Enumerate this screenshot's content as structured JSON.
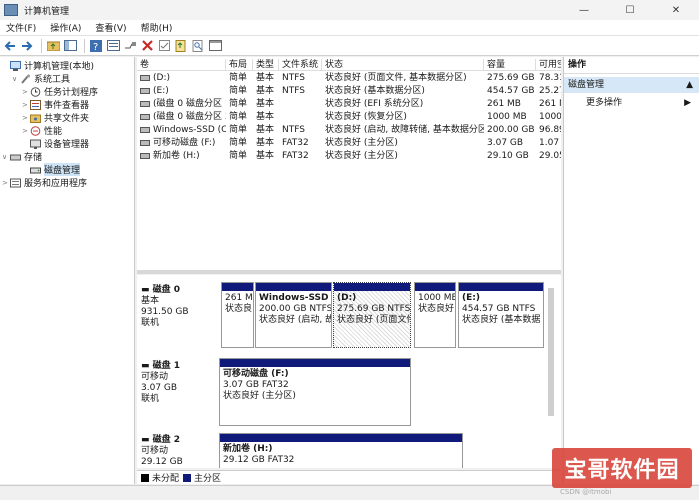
{
  "window": {
    "title": "计算机管理",
    "minimize": "—",
    "maximize": "☐",
    "close": "✕"
  },
  "menu": [
    "文件(F)",
    "操作(A)",
    "查看(V)",
    "帮助(H)"
  ],
  "toolbar_icons": [
    "back-arrow-icon",
    "forward-arrow-icon",
    "folder-up-icon",
    "show-tree-icon",
    "help-icon",
    "properties-icon",
    "connect-icon",
    "delete-icon",
    "check-icon",
    "export-icon",
    "search-icon",
    "window-icon"
  ],
  "tree": [
    {
      "label": "计算机管理(本地)",
      "level": 0,
      "expander": "",
      "icon": "computer-icon"
    },
    {
      "label": "系统工具",
      "level": 1,
      "expander": "∨",
      "icon": "tools-icon"
    },
    {
      "label": "任务计划程序",
      "level": 2,
      "expander": ">",
      "icon": "clock-icon"
    },
    {
      "label": "事件查看器",
      "level": 2,
      "expander": ">",
      "icon": "event-viewer-icon"
    },
    {
      "label": "共享文件夹",
      "level": 2,
      "expander": ">",
      "icon": "shared-folder-icon"
    },
    {
      "label": "性能",
      "level": 2,
      "expander": ">",
      "icon": "performance-icon"
    },
    {
      "label": "设备管理器",
      "level": 2,
      "expander": "",
      "icon": "device-manager-icon"
    },
    {
      "label": "存储",
      "level": 1,
      "expander": "∨",
      "icon": "storage-icon"
    },
    {
      "label": "磁盘管理",
      "level": 2,
      "expander": "",
      "icon": "disk-management-icon",
      "selected": true
    },
    {
      "label": "服务和应用程序",
      "level": 1,
      "expander": ">",
      "icon": "services-icon"
    }
  ],
  "volume_table": {
    "columns": [
      "卷",
      "布局",
      "类型",
      "文件系统",
      "状态",
      "容量",
      "可用空"
    ],
    "rows": [
      [
        "(D:)",
        "简单",
        "基本",
        "NTFS",
        "状态良好 (页面文件, 基本数据分区)",
        "275.69 GB",
        "78.31"
      ],
      [
        "(E:)",
        "简单",
        "基本",
        "NTFS",
        "状态良好 (基本数据分区)",
        "454.57 GB",
        "25.27"
      ],
      [
        "(磁盘 0 磁盘分区 1)",
        "简单",
        "基本",
        "",
        "状态良好 (EFI 系统分区)",
        "261 MB",
        "261 M"
      ],
      [
        "(磁盘 0 磁盘分区 3)",
        "简单",
        "基本",
        "",
        "状态良好 (恢复分区)",
        "1000 MB",
        "1000"
      ],
      [
        "Windows-SSD (C:)",
        "简单",
        "基本",
        "NTFS",
        "状态良好 (启动, 故障转储, 基本数据分区)",
        "200.00 GB",
        "96.89"
      ],
      [
        "可移动磁盘 (F:)",
        "简单",
        "基本",
        "FAT32",
        "状态良好 (主分区)",
        "3.07 GB",
        "1.07 C"
      ],
      [
        "新加卷 (H:)",
        "简单",
        "基本",
        "FAT32",
        "状态良好 (主分区)",
        "29.10 GB",
        "29.05"
      ]
    ]
  },
  "disks": [
    {
      "name": "磁盘 0",
      "type": "基本",
      "size": "931.50 GB",
      "status": "联机",
      "partitions": [
        {
          "title": "",
          "line1": "261 M",
          "line2": "状态良"
        },
        {
          "title": "Windows-SSD (",
          "line1": "200.00 GB NTFS",
          "line2": "状态良好 (启动, 故"
        },
        {
          "title": "(D:)",
          "line1": "275.69 GB NTFS",
          "line2": "状态良好 (页面文件"
        },
        {
          "title": "",
          "line1": "1000 ME",
          "line2": "状态良好"
        },
        {
          "title": "(E:)",
          "line1": "454.57 GB NTFS",
          "line2": "状态良好 (基本数据"
        }
      ]
    },
    {
      "name": "磁盘 1",
      "type": "可移动",
      "size": "3.07 GB",
      "status": "联机",
      "partitions": [
        {
          "title": "可移动磁盘 (F:)",
          "line1": "3.07 GB FAT32",
          "line2": "状态良好 (主分区)"
        }
      ]
    },
    {
      "name": "磁盘 2",
      "type": "可移动",
      "size": "29.12 GB",
      "status": "",
      "partitions": [
        {
          "title": "新加卷 (H:)",
          "line1": "29.12 GB FAT32",
          "line2": ""
        }
      ]
    }
  ],
  "legend": [
    {
      "label": "未分配",
      "color": "#000000"
    },
    {
      "label": "主分区",
      "color": "#101a7a"
    }
  ],
  "actions": {
    "header": "操作",
    "section": "磁盘管理",
    "section_arrow": "▲",
    "item": "更多操作",
    "item_arrow": "▶"
  },
  "watermark": {
    "text": "宝哥软件园",
    "sub": "CSDN @itmobi"
  }
}
